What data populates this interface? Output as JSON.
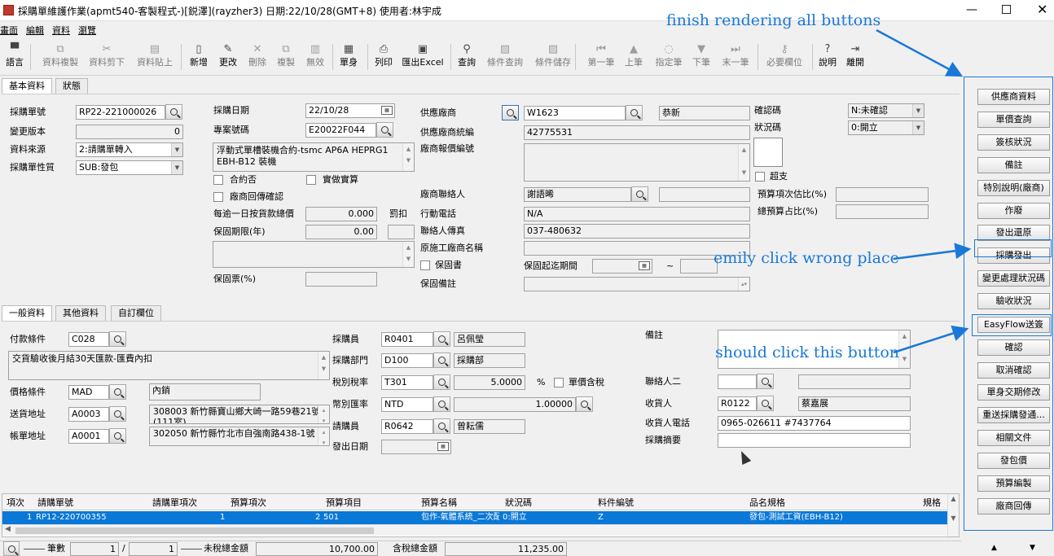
{
  "window": {
    "title": "採購單維護作業(apmt540-客製程式-)[鋭澤](rayzher3) 日期:22/10/28(GMT+8) 使用者:林宇成"
  },
  "menu": [
    "畫面",
    "編輯",
    "資料",
    "瀏覽"
  ],
  "toolbar": [
    {
      "label": "語言",
      "icon": "▀",
      "dis": false
    },
    {
      "label": "資料複製",
      "icon": "⧉",
      "dis": true
    },
    {
      "label": "資料剪下",
      "icon": "✂",
      "dis": true
    },
    {
      "label": "資料貼上",
      "icon": "▤",
      "dis": true
    },
    {
      "label": "新增",
      "icon": "▯",
      "dis": false
    },
    {
      "label": "更改",
      "icon": "✎",
      "dis": false
    },
    {
      "label": "刪除",
      "icon": "✕",
      "dis": true
    },
    {
      "label": "複製",
      "icon": "⧉",
      "dis": true
    },
    {
      "label": "無效",
      "icon": "▥",
      "dis": true
    },
    {
      "label": "單身",
      "icon": "▦",
      "dis": false
    },
    {
      "label": "列印",
      "icon": "⎙",
      "dis": false
    },
    {
      "label": "匯出Excel",
      "icon": "▣",
      "dis": false
    },
    {
      "label": "查詢",
      "icon": "⚲",
      "dis": false
    },
    {
      "label": "條件查詢",
      "icon": "▧",
      "dis": true
    },
    {
      "label": "條件儲存",
      "icon": "▨",
      "dis": true
    },
    {
      "label": "第一筆",
      "icon": "⏮",
      "dis": true
    },
    {
      "label": "上筆",
      "icon": "▲",
      "dis": true
    },
    {
      "label": "指定筆",
      "icon": "◌",
      "dis": true
    },
    {
      "label": "下筆",
      "icon": "▼",
      "dis": true
    },
    {
      "label": "末一筆",
      "icon": "⏭",
      "dis": true
    },
    {
      "label": "必要欄位",
      "icon": "⚷",
      "dis": true
    },
    {
      "label": "說明",
      "icon": "?",
      "dis": false
    },
    {
      "label": "離開",
      "icon": "⇥",
      "dis": false
    }
  ],
  "tabs_top": [
    "基本資料",
    "狀態"
  ],
  "basic": {
    "po_no_label": "採購單號",
    "po_no": "RP22-221000026",
    "ver_label": "變更版本",
    "ver": "0",
    "src_label": "資料來源",
    "src": "2:請購單轉入",
    "nature_label": "採購單性質",
    "nature": "SUB:發包",
    "date_label": "採購日期",
    "date": "22/10/28",
    "proj_label": "專案號碼",
    "proj": "E20022F044",
    "proj_desc": "浮動式單槽裝機合約-tsmc AP6A HEPRG1\nEBH-B12 裝機",
    "contract_label": "合約否",
    "actual_label": "實做實算",
    "vendor_back_label": "廠商回傳確認",
    "penalty_label": "每逾一日按貨款總價",
    "penalty": "0.000",
    "penalty_unit": "罰扣",
    "warranty_label": "保固期限(年)",
    "warranty": "0.00",
    "warranty_ticket_label": "保固票(%)",
    "vendor_label": "供應廠商",
    "vendor": "W1623",
    "vendor_name": "恭新",
    "tax_id_label": "供應廠商統編",
    "tax_id": "42775531",
    "quote_label": "廠商報價編號",
    "contact_label": "廠商聯絡人",
    "contact": "謝語晞",
    "mobile_label": "行動電話",
    "mobile": "N/A",
    "fax_label": "聯絡人傳真",
    "fax": "037-480632",
    "orig_vendor_label": "原施工廠商名稱",
    "warranty_doc_label": "保固書",
    "warranty_period_label": "保固起迄期間",
    "tilde": "~",
    "warranty_note_label": "保固備註",
    "confirm_label": "確認碼",
    "confirm": "N:未確認",
    "status_label": "狀況碼",
    "status": "0:開立",
    "overpay_label": "超支",
    "budget_est_label": "預算項次估比(%)",
    "budget_total_label": "總預算占比(%)"
  },
  "tabs_mid": [
    "一般資料",
    "其他資料",
    "自訂欄位"
  ],
  "general": {
    "pay_label": "付款條件",
    "pay": "C028",
    "pay_desc": "交貨驗收後月結30天匯款-匯費內扣",
    "price_label": "價格條件",
    "price": "MAD",
    "price_desc": "內銷",
    "ship_label": "送貨地址",
    "ship": "A0003",
    "ship_desc": "308003 新竹縣寶山鄉大崎一路59巷21號(111室)",
    "bill_label": "帳單地址",
    "bill": "A0001",
    "bill_desc": "302050 新竹縣竹北市自強南路438-1號",
    "buyer_label": "採購員",
    "buyer": "R0401",
    "buyer_name": "呂佩瑩",
    "dept_label": "採購部門",
    "dept": "D100",
    "dept_name": "採購部",
    "tax_label": "稅別稅率",
    "tax": "T301",
    "tax_rate": "5.0000",
    "pct": "%",
    "tax_incl_label": "單價含稅",
    "cur_label": "幣別匯率",
    "cur": "NTD",
    "cur_rate": "1.00000",
    "req_label": "請購員",
    "req": "R0642",
    "req_name": "曾耘儒",
    "issue_label": "發出日期",
    "remark_label": "備註",
    "contact2_label": "聯絡人二",
    "recv_label": "收貨人",
    "recv": "R0122",
    "recv_name": "蔡嘉展",
    "recv_tel_label": "收貨人電話",
    "recv_tel": "0965-026611 #7437764",
    "summary_label": "採購摘要"
  },
  "grid": {
    "headers": [
      "項次",
      "請購單號",
      "請購單項次",
      "預算項次",
      "預算項目",
      "預算名稱",
      "狀況碼",
      "料件編號",
      "品名規格",
      "規格"
    ],
    "row": [
      "1",
      "RP12-220700355",
      "1",
      "2",
      "501",
      "包作-氣體系統_二次配",
      "0:開立",
      "Z",
      "發包-測試工資(EBH-B12)"
    ]
  },
  "footer": {
    "count_label": "筆數",
    "cur": "1",
    "slash": "/",
    "total": "1",
    "untaxed_label": "未稅總金額",
    "untaxed": "10,700.00",
    "taxed_label": "含稅總金額",
    "taxed": "11,235.00"
  },
  "side_buttons": [
    "供應商資料",
    "單價查詢",
    "簽核狀況",
    "備註",
    "特別說明(廠商)",
    "作廢",
    "發出還原",
    "採購發出",
    "變更處理狀況碼",
    "驗收狀況",
    "EasyFlow送簽",
    "確認",
    "取消確認",
    "單身交期修改",
    "重送採購發通...",
    "相關文件",
    "發包價",
    "預算編製",
    "廠商回傳"
  ],
  "annotations": {
    "finish": "finish rendering all buttons",
    "wrong": "emily click wrong place",
    "should": "should click this button"
  },
  "colors": {
    "accent": "#1a78d8",
    "selection": "#0a78d7"
  }
}
